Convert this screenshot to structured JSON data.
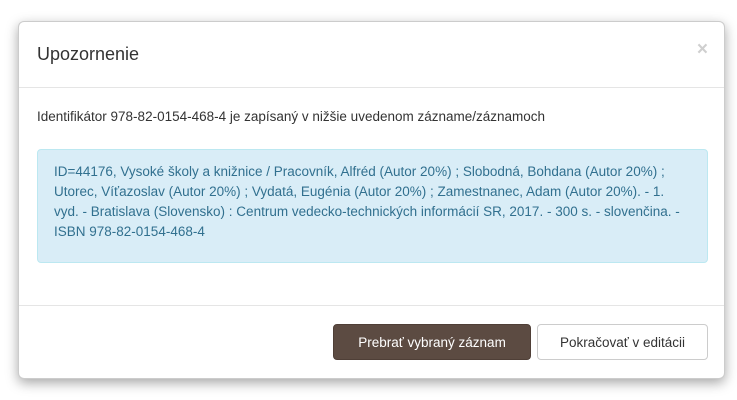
{
  "dialog": {
    "title": "Upozornenie",
    "close_symbol": "×",
    "close_icon": "close-icon"
  },
  "body": {
    "intro": "Identifikátor 978-82-0154-468-4 je zapísaný v nižšie uvedenom zázname/záznamoch",
    "record": "ID=44176, Vysoké školy a knižnice / Pracovník, Alfréd (Autor 20%) ; Slobodná, Bohdana (Autor 20%) ; Utorec, Víťazoslav (Autor 20%) ; Vydatá, Eugénia (Autor 20%) ; Zamestnanec, Adam (Autor 20%). - 1. vyd. - Bratislava (Slovensko) : Centrum vedecko-technických informácií SR, 2017. - 300 s. - slovenčina. - ISBN 978-82-0154-468-4"
  },
  "footer": {
    "accept_label": "Prebrať vybraný záznam",
    "continue_label": "Pokračovať v editácii"
  },
  "colors": {
    "primary_button": "#5c4b42",
    "info_background": "#d9edf7",
    "info_text": "#31708f"
  }
}
